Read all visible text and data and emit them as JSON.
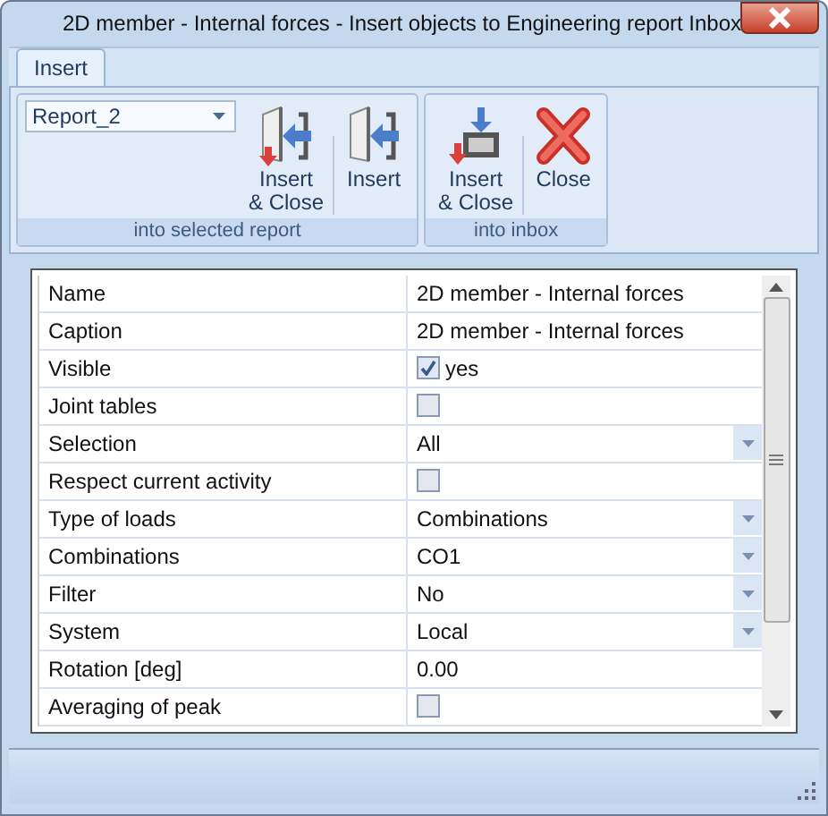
{
  "window": {
    "title": "2D member - Internal forces - Insert objects to Engineering report Inbox"
  },
  "tabs": [
    {
      "label": "Insert",
      "selected": true
    }
  ],
  "ribbon": {
    "report_dropdown": {
      "value": "Report_2"
    },
    "groups": [
      {
        "label": "into selected report",
        "buttons": [
          {
            "label": "Insert\n& Close",
            "kind": "report-insert-close"
          },
          {
            "label": "Insert",
            "kind": "report-insert"
          }
        ]
      },
      {
        "label": "into inbox",
        "buttons": [
          {
            "label": "Insert\n& Close",
            "kind": "inbox-insert-close"
          },
          {
            "label": "Close",
            "kind": "close"
          }
        ]
      }
    ]
  },
  "properties": [
    {
      "name": "Name",
      "kind": "text",
      "value": "2D member - Internal forces"
    },
    {
      "name": "Caption",
      "kind": "text",
      "value": "2D member - Internal forces"
    },
    {
      "name": "Visible",
      "kind": "checkbox",
      "checked": true,
      "value": "yes"
    },
    {
      "name": "Joint tables",
      "kind": "checkbox",
      "checked": false
    },
    {
      "name": "Selection",
      "kind": "dropdown",
      "value": "All"
    },
    {
      "name": "Respect current activity",
      "kind": "checkbox",
      "checked": false
    },
    {
      "name": "Type of loads",
      "kind": "dropdown",
      "value": "Combinations"
    },
    {
      "name": "Combinations",
      "kind": "dropdown",
      "value": "CO1"
    },
    {
      "name": "Filter",
      "kind": "dropdown",
      "value": "No"
    },
    {
      "name": "System",
      "kind": "dropdown",
      "value": "Local"
    },
    {
      "name": "Rotation [deg]",
      "kind": "text",
      "value": "0.00"
    },
    {
      "name": "Averaging of peak",
      "kind": "checkbox",
      "checked": false
    }
  ]
}
